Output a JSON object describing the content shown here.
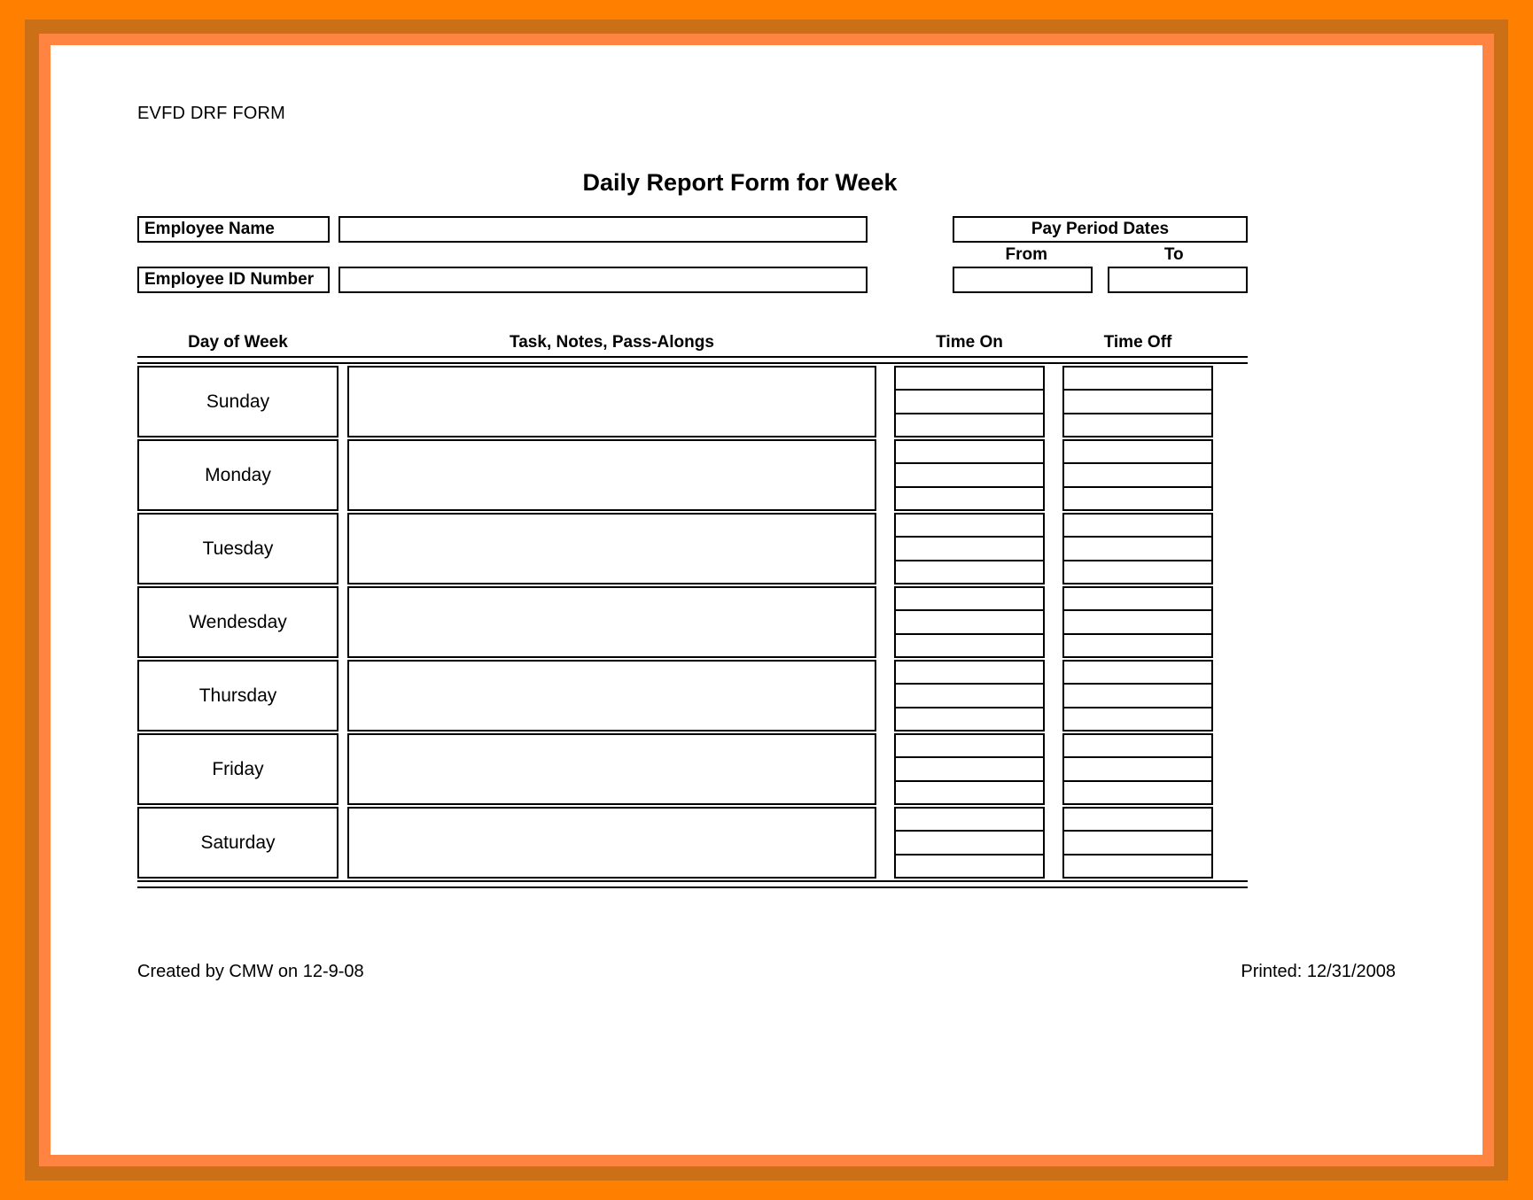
{
  "document": {
    "form_code": "EVFD DRF FORM",
    "title": "Daily Report Form for Week"
  },
  "identity": {
    "employee_name_label": "Employee Name",
    "employee_name_value": "",
    "employee_id_label": "Employee ID Number",
    "employee_id_value": "",
    "pay_period_header": "Pay Period Dates",
    "from_label": "From",
    "to_label": "To",
    "from_value": "",
    "to_value": ""
  },
  "table": {
    "headers": {
      "day": "Day of Week",
      "task": "Task, Notes, Pass-Alongs",
      "time_on": "Time On",
      "time_off": "Time Off"
    },
    "rows": [
      {
        "day": "Sunday",
        "task": "",
        "time_on": [
          "",
          "",
          ""
        ],
        "time_off": [
          "",
          "",
          ""
        ]
      },
      {
        "day": "Monday",
        "task": "",
        "time_on": [
          "",
          "",
          ""
        ],
        "time_off": [
          "",
          "",
          ""
        ]
      },
      {
        "day": "Tuesday",
        "task": "",
        "time_on": [
          "",
          "",
          ""
        ],
        "time_off": [
          "",
          "",
          ""
        ]
      },
      {
        "day": "Wendesday",
        "task": "",
        "time_on": [
          "",
          "",
          ""
        ],
        "time_off": [
          "",
          "",
          ""
        ]
      },
      {
        "day": "Thursday",
        "task": "",
        "time_on": [
          "",
          "",
          ""
        ],
        "time_off": [
          "",
          "",
          ""
        ]
      },
      {
        "day": "Friday",
        "task": "",
        "time_on": [
          "",
          "",
          ""
        ],
        "time_off": [
          "",
          "",
          ""
        ]
      },
      {
        "day": "Saturday",
        "task": "",
        "time_on": [
          "",
          "",
          ""
        ],
        "time_off": [
          "",
          "",
          ""
        ]
      }
    ]
  },
  "footer": {
    "created": "Created by CMW on 12-9-08",
    "printed": "Printed: 12/31/2008"
  },
  "theme": {
    "border_outer": "#ff8000",
    "border_mid": "#cc7018",
    "border_inner": "#ff8442",
    "paper": "#ffffff",
    "ink": "#000000"
  }
}
